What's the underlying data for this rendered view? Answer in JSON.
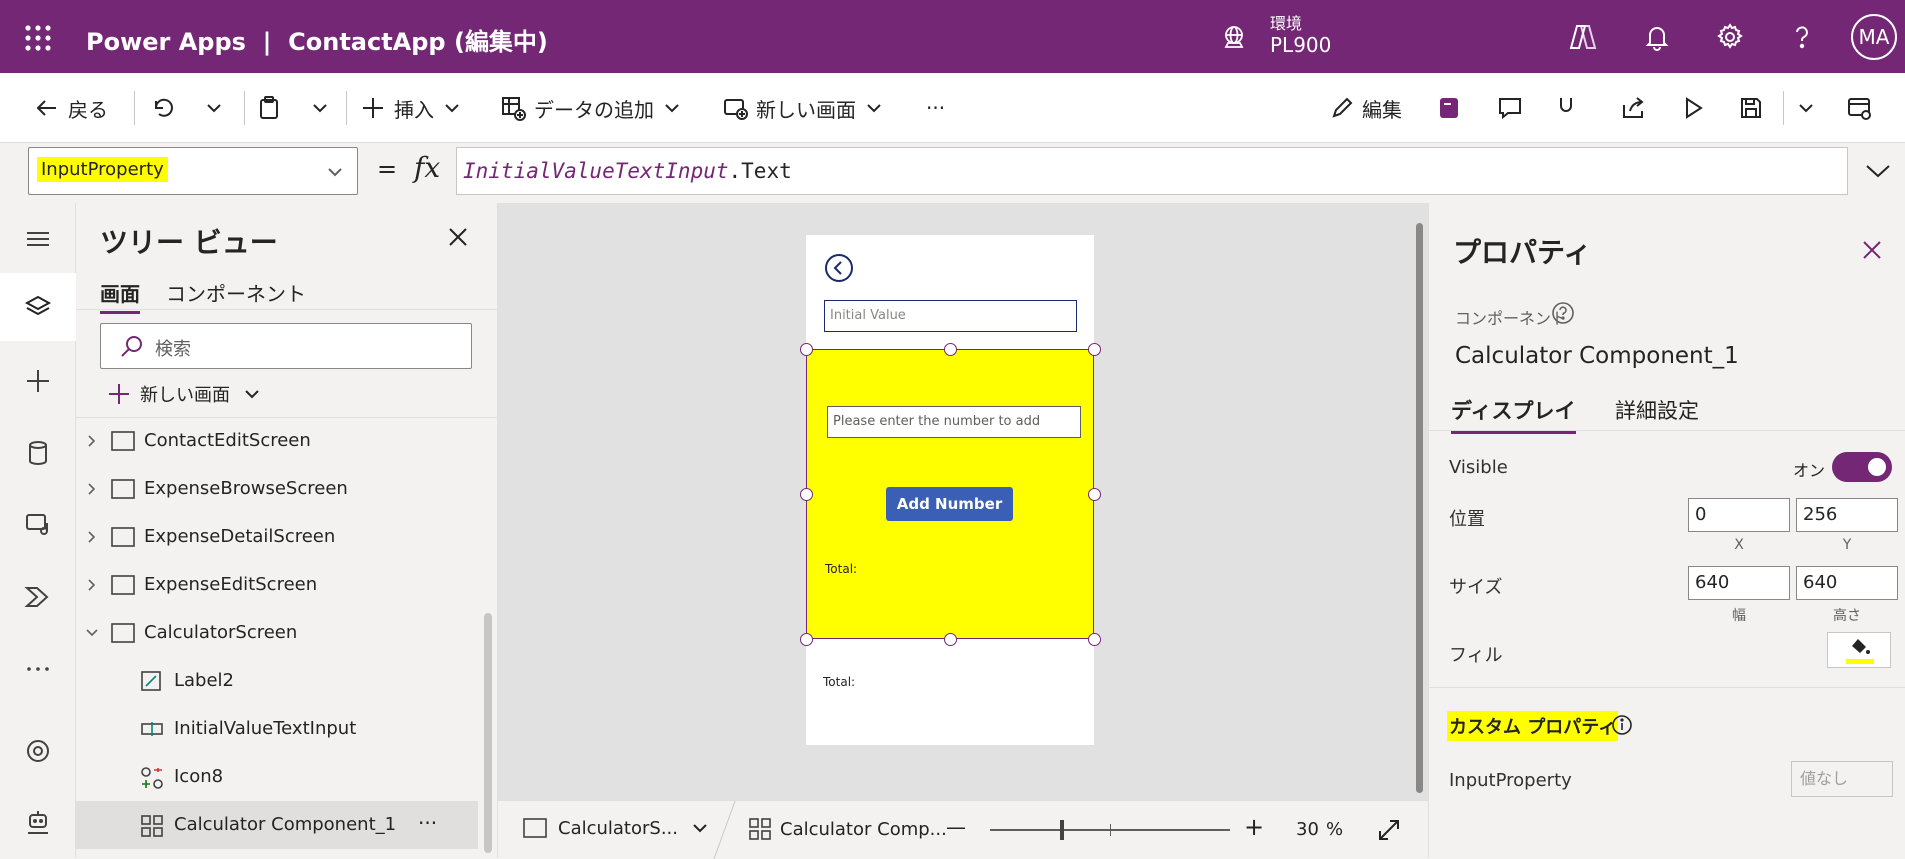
{
  "topbar": {
    "app_title": "Power Apps  |  ContactApp (編集中)",
    "env_label": "環境",
    "env_value": "PL900",
    "avatar": "MA"
  },
  "toolbar": {
    "back": "戻る",
    "insert": "挿入",
    "add_data": "データの追加",
    "new_screen": "新しい画面",
    "more": "···",
    "edit": "編集"
  },
  "formula": {
    "property": "InputProperty",
    "equals": "=",
    "fx": "fx",
    "ref": "InitialValueTextInput",
    "suffix": ".Text"
  },
  "tree": {
    "title": "ツリー ビュー",
    "tab_screens": "画面",
    "tab_components": "コンポーネント",
    "search_placeholder": "検索",
    "new_screen": "新しい画面",
    "nodes": [
      "ContactEditScreen",
      "ExpenseBrowseScreen",
      "ExpenseDetailScreen",
      "ExpenseEditScreen",
      "CalculatorScreen",
      "Label2",
      "InitialValueTextInput",
      "Icon8",
      "Calculator Component_1"
    ],
    "more": "···"
  },
  "canvas": {
    "initial_value_placeholder": "Initial Value",
    "number_placeholder": "Please enter the number to add",
    "add_button": "Add Number",
    "total_inner": "Total:",
    "total_outer": "Total:",
    "component_fill": "#ffff00"
  },
  "statusbar": {
    "screen": "CalculatorS...",
    "component": "Calculator Comp...",
    "zoom": "30",
    "zoom_unit": "%",
    "minus": "—",
    "plus": "+",
    "zoom_fraction": 0.3
  },
  "properties": {
    "title": "プロパティ",
    "type_label": "コンポーネント",
    "component_name": "Calculator Component_1",
    "tab_display": "ディスプレイ",
    "tab_advanced": "詳細設定",
    "visible_label": "Visible",
    "visible_value": "オン",
    "position_label": "位置",
    "x_value": "0",
    "x_label": "X",
    "y_value": "256",
    "y_label": "Y",
    "size_label": "サイズ",
    "width_value": "640",
    "width_label": "幅",
    "height_value": "640",
    "height_label": "高さ",
    "fill_label": "フィル",
    "custom_props": "カスタム プロパティ",
    "input_property": "InputProperty",
    "no_value": "値なし"
  },
  "colors": {
    "brand": "#742774",
    "highlight": "#ffff00",
    "button": "#3b5fb5"
  }
}
